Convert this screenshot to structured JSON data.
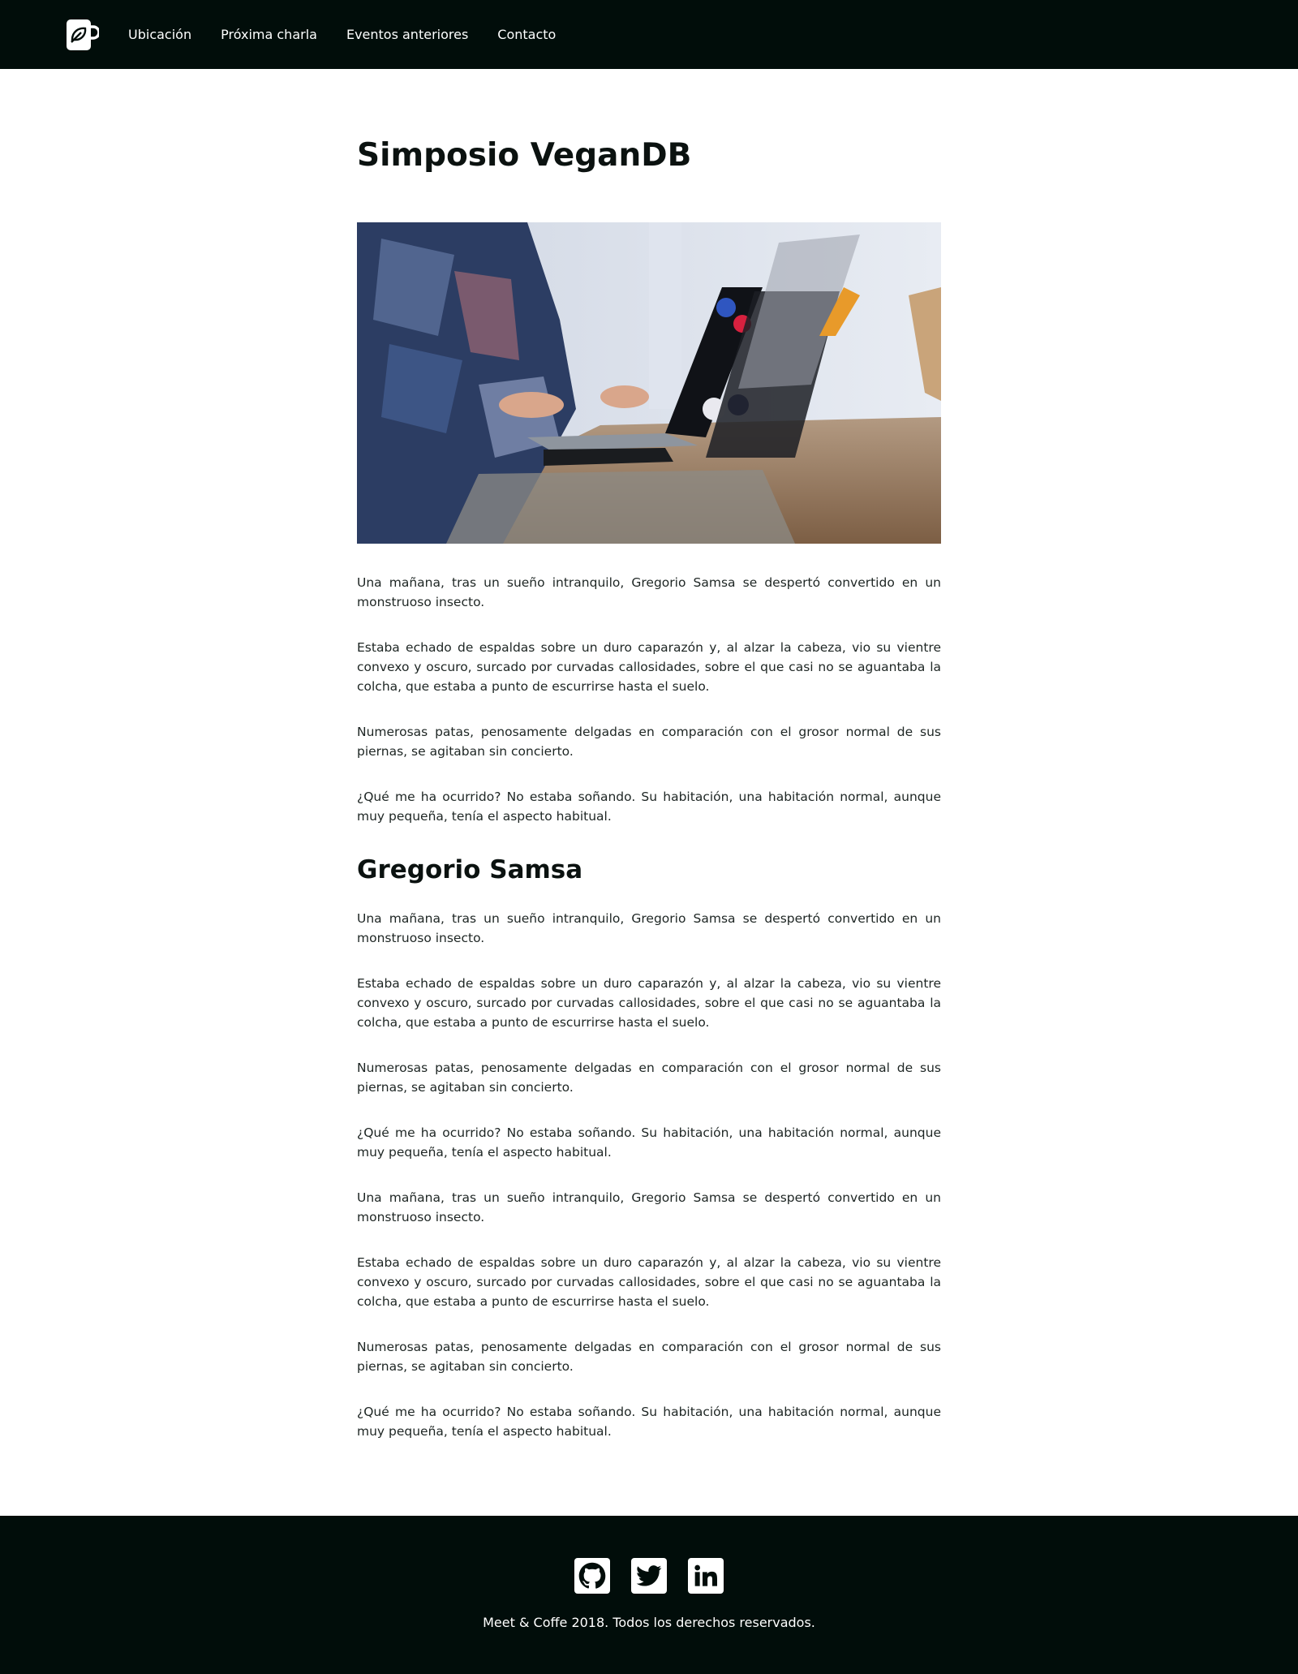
{
  "header": {
    "logo_icon": "coffee-cup-leaf-icon",
    "nav": [
      {
        "label": "Ubicación"
      },
      {
        "label": "Próxima charla"
      },
      {
        "label": "Eventos anteriores"
      },
      {
        "label": "Contacto"
      }
    ]
  },
  "main": {
    "title": "Simposio VeganDB",
    "hero_image": "person-working-on-laptop-photo",
    "intro_paragraphs": [
      "Una mañana, tras un sueño intranquilo, Gregorio Samsa se despertó convertido en un monstruoso insecto.",
      "Estaba echado de espaldas sobre un duro caparazón y, al alzar la cabeza, vio su vientre convexo y oscuro, surcado por curvadas callosidades, sobre el que casi no se aguantaba la colcha, que estaba a punto de escurrirse hasta el suelo.",
      "Numerosas patas, penosamente delgadas en comparación con el grosor normal de sus piernas, se agitaban sin concierto.",
      "¿Qué me ha ocurrido? No estaba soñando. Su habitación, una habitación normal, aunque muy pequeña, tenía el aspecto habitual."
    ],
    "section_title": "Gregorio Samsa",
    "section_paragraphs": [
      "Una mañana, tras un sueño intranquilo, Gregorio Samsa se despertó convertido en un monstruoso insecto.",
      "Estaba echado de espaldas sobre un duro caparazón y, al alzar la cabeza, vio su vientre convexo y oscuro, surcado por curvadas callosidades, sobre el que casi no se aguantaba la colcha, que estaba a punto de escurrirse hasta el suelo.",
      "Numerosas patas, penosamente delgadas en comparación con el grosor normal de sus piernas, se agitaban sin concierto.",
      "¿Qué me ha ocurrido? No estaba soñando. Su habitación, una habitación normal, aunque muy pequeña, tenía el aspecto habitual.",
      "Una mañana, tras un sueño intranquilo, Gregorio Samsa se despertó convertido en un monstruoso insecto.",
      "Estaba echado de espaldas sobre un duro caparazón y, al alzar la cabeza, vio su vientre convexo y oscuro, surcado por curvadas callosidades, sobre el que casi no se aguantaba la colcha, que estaba a punto de escurrirse hasta el suelo.",
      "Numerosas patas, penosamente delgadas en comparación con el grosor normal de sus piernas, se agitaban sin concierto.",
      "¿Qué me ha ocurrido? No estaba soñando. Su habitación, una habitación normal, aunque muy pequeña, tenía el aspecto habitual."
    ]
  },
  "footer": {
    "social": [
      {
        "icon": "github-icon"
      },
      {
        "icon": "twitter-icon"
      },
      {
        "icon": "linkedin-icon"
      }
    ],
    "copyright": "Meet & Coffe 2018. Todos los derechos reservados."
  },
  "colors": {
    "header_bg": "#010d0a",
    "footer_bg": "#010d0a",
    "text": "#1d2523"
  }
}
